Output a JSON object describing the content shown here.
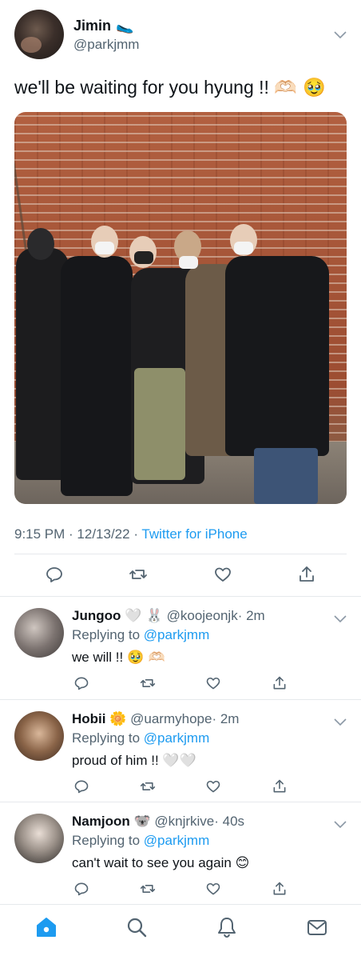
{
  "main_tweet": {
    "author_name": "Jimin",
    "author_badge_emoji": "🥿",
    "author_handle": "@parkjmm",
    "text": "we'll be waiting for you hyung !!",
    "text_emojis": "🫶🏻 🥹",
    "timestamp": "9:15 PM · 12/13/22 ·",
    "source": "Twitter for iPhone",
    "icons": [
      "reply-icon",
      "retweet-icon",
      "like-icon",
      "share-icon"
    ]
  },
  "replies": [
    {
      "name": "Jungoo",
      "badges": "🤍 🐰",
      "handle": "@koojeonjk",
      "time": "· 2m",
      "replying_prefix": "Replying to",
      "replying_to": "@parkjmm",
      "text": "we will !!",
      "text_emojis": "🥹 🫶🏻"
    },
    {
      "name": "Hobii",
      "badges": "🌼",
      "handle": "@uarmyhope",
      "time": "· 2m",
      "replying_prefix": "Replying to",
      "replying_to": "@parkjmm",
      "text": "proud of him !!",
      "text_emojis": "🤍🤍"
    },
    {
      "name": "Namjoon",
      "badges": "🐨",
      "handle": "@knjrkive",
      "time": "· 40s",
      "replying_prefix": "Replying to",
      "replying_to": "@parkjmm",
      "text": "can't wait to see you again",
      "text_emojis": "😊"
    }
  ],
  "tab_bar": {
    "tabs": [
      "home-icon",
      "search-icon",
      "notifications-icon",
      "messages-icon"
    ],
    "active": "home-icon"
  },
  "colors": {
    "accent": "#1d9bf0",
    "secondary_text": "#536471",
    "icon_gray": "#536471",
    "divider": "#e6e9ec"
  }
}
